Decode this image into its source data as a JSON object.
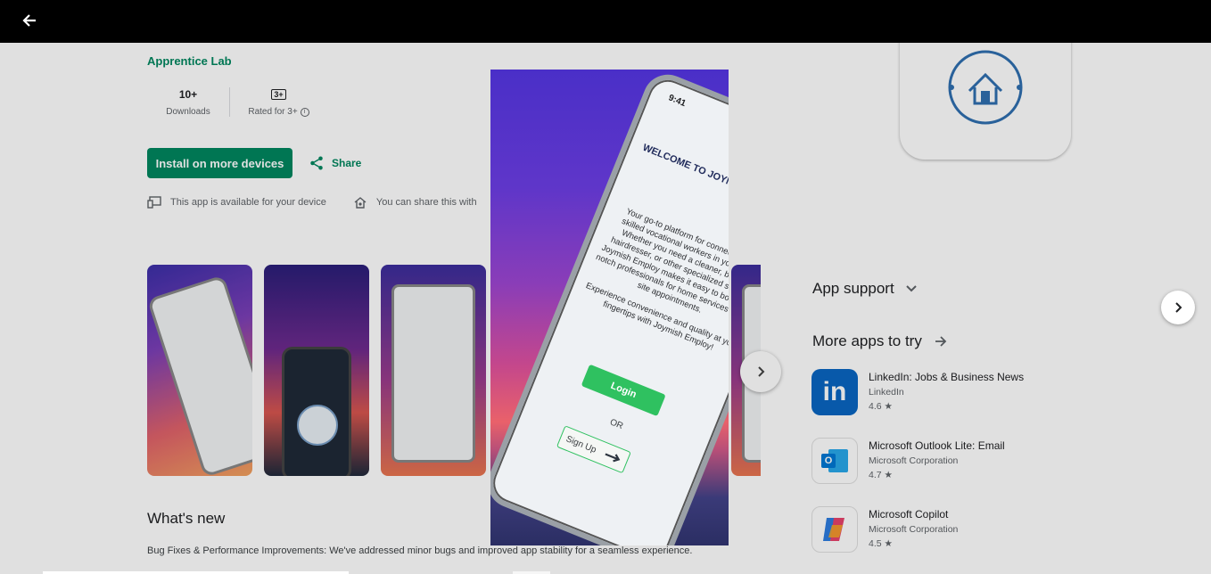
{
  "header": {
    "back_icon": "arrow-left-icon"
  },
  "app": {
    "developer": "Apprentice Lab",
    "downloads_value": "10+",
    "downloads_label": "Downloads",
    "rating_badge": "3+",
    "rating_label": "Rated for 3+"
  },
  "actions": {
    "install_label": "Install on more devices",
    "share_label": "Share"
  },
  "availability": {
    "device_text": "This app is available for your device",
    "share_text": "You can share this with"
  },
  "screenshots": {
    "count_visible": 5
  },
  "whats_new": {
    "title": "What's new",
    "notes": "Bug Fixes & Performance Improvements: We've addressed minor bugs and improved app stability for a seamless experience."
  },
  "sidebar": {
    "app_support": "App support",
    "more_apps": "More apps to try",
    "recommendations": [
      {
        "title": "LinkedIn: Jobs & Business News",
        "developer": "LinkedIn",
        "rating": "4.6 ★"
      },
      {
        "title": "Microsoft Outlook Lite: Email",
        "developer": "Microsoft Corporation",
        "rating": "4.7 ★"
      },
      {
        "title": "Microsoft Copilot",
        "developer": "Microsoft Corporation",
        "rating": "4.5 ★"
      }
    ]
  },
  "viewer": {
    "phone_time": "9:41",
    "welcome_title": "WELCOME TO JOYMISH EMPLOY",
    "body_1": "Your go-to platform for connecting with skilled vocational workers in your area. Whether you need a cleaner, barber, hairdresser, or other specialized service, Joymish Employ makes it easy to book top-notch professionals for home services or on-site appointments.",
    "body_2": "Experience convenience and quality at your fingertips with Joymish Employ!",
    "login_label": "Login",
    "or_label": "OR",
    "signup_label": "Sign Up"
  },
  "colors": {
    "brand_green": "#01875f",
    "login_green": "#2fc160",
    "linkedin_blue": "#0a66c2",
    "outlook_blue": "#0078d4"
  }
}
